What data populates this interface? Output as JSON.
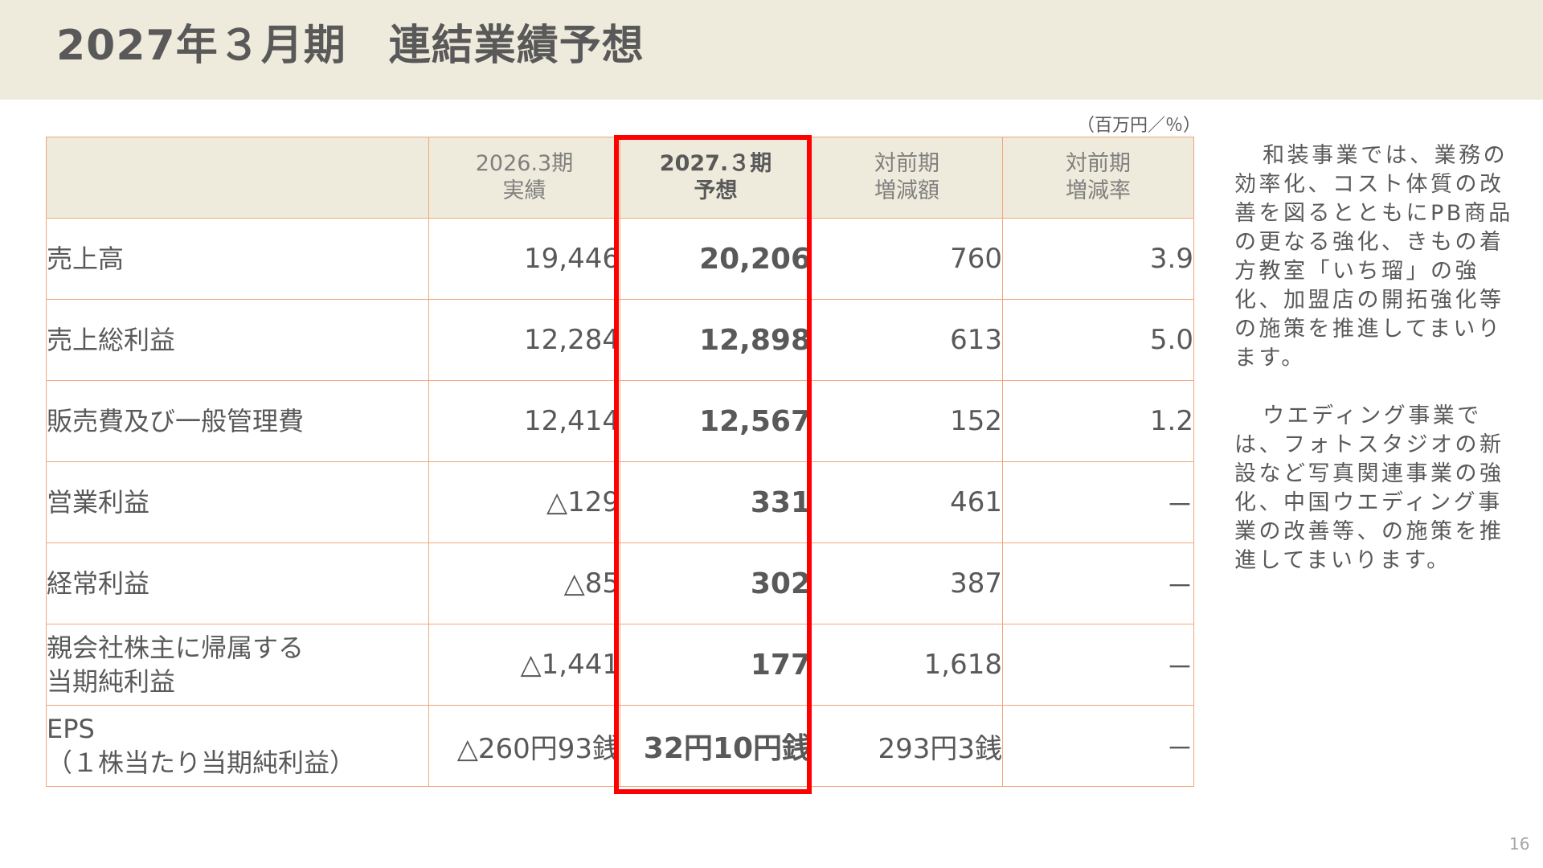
{
  "title": "2027年３月期　連結業績予想",
  "unit_note": "（百万円／％）",
  "table": {
    "headers": [
      {
        "lines": [
          "2026.3期",
          "実績"
        ]
      },
      {
        "lines": [
          "2027.３期",
          "予想"
        ]
      },
      {
        "lines": [
          "対前期",
          "増減額"
        ]
      },
      {
        "lines": [
          "対前期",
          "増減率"
        ]
      }
    ],
    "rows": [
      {
        "label": [
          "売上高"
        ],
        "actual": "19,446",
        "forecast": "20,206",
        "change": "760",
        "rate": "3.9"
      },
      {
        "label": [
          "売上総利益"
        ],
        "actual": "12,284",
        "forecast": "12,898",
        "change": "613",
        "rate": "5.0"
      },
      {
        "label": [
          "販売費及び一般管理費"
        ],
        "actual": "12,414",
        "forecast": "12,567",
        "change": "152",
        "rate": "1.2"
      },
      {
        "label": [
          "営業利益"
        ],
        "actual": "△129",
        "forecast": "331",
        "change": "461",
        "rate": "－"
      },
      {
        "label": [
          "経常利益"
        ],
        "actual": "△85",
        "forecast": "302",
        "change": "387",
        "rate": "－"
      },
      {
        "label": [
          "親会社株主に帰属する",
          "当期純利益"
        ],
        "actual": "△1,441",
        "forecast": "177",
        "change": "1,618",
        "rate": "－"
      },
      {
        "label": [
          "EPS",
          "（１株当たり当期純利益）"
        ],
        "actual": "△260円93銭",
        "forecast": "32円10円銭",
        "change": "293円3銭",
        "rate": "－"
      }
    ]
  },
  "commentary": {
    "paragraphs": [
      "和装事業では、業務の効率化、コスト体質の改善を図るとともにPB商品の更なる強化、きもの着方教室「いち瑠」の強化、加盟店の開拓強化等の施策を推進してまいります。",
      "ウエディング事業では、フォトスタジオの新設など写真関連事業の強化、中国ウエディング事業の改善等、の施策を推進してまいります。"
    ]
  },
  "page_number": "16",
  "colors": {
    "title_bar": "#efebdc",
    "header_fill": "#efebdc",
    "table_border": "#f0a87a",
    "highlight_frame": "#ff0000",
    "text": "#595959"
  }
}
